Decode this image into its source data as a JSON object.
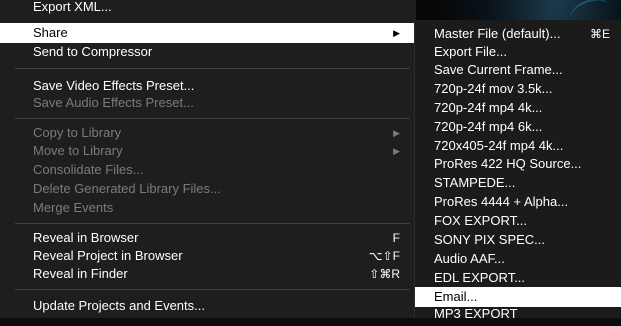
{
  "main_menu": {
    "items": [
      {
        "label": "Export XML...",
        "enabled": true
      },
      {
        "label": "Share",
        "enabled": true,
        "submenu": true,
        "selected": true
      },
      {
        "label": "Send to Compressor",
        "enabled": true
      },
      {
        "label": "Save Video Effects Preset...",
        "enabled": true
      },
      {
        "label": "Save Audio Effects Preset...",
        "enabled": false
      },
      {
        "label": "Copy to Library",
        "enabled": false,
        "submenu": true
      },
      {
        "label": "Move to Library",
        "enabled": false,
        "submenu": true
      },
      {
        "label": "Consolidate Files...",
        "enabled": false
      },
      {
        "label": "Delete Generated Library Files...",
        "enabled": false
      },
      {
        "label": "Merge Events",
        "enabled": false
      },
      {
        "label": "Reveal in Browser",
        "enabled": true,
        "shortcut": "F"
      },
      {
        "label": "Reveal Project in Browser",
        "enabled": true,
        "shortcut": "⌥⇧F"
      },
      {
        "label": "Reveal in Finder",
        "enabled": true,
        "shortcut": "⇧⌘R"
      },
      {
        "label": "Update Projects and Events...",
        "enabled": true
      }
    ],
    "submenu_arrow": "▶"
  },
  "share_submenu": {
    "items": [
      {
        "label": "Master File (default)...",
        "shortcut": "⌘E"
      },
      {
        "label": "Export File..."
      },
      {
        "label": "Save Current Frame..."
      },
      {
        "label": "720p-24f mov 3.5k..."
      },
      {
        "label": "720p-24f mp4 4k..."
      },
      {
        "label": "720p-24f mp4 6k..."
      },
      {
        "label": "720x405-24f mp4 4k..."
      },
      {
        "label": "ProRes 422 HQ Source..."
      },
      {
        "label": "STAMPEDE..."
      },
      {
        "label": "ProRes 4444 + Alpha..."
      },
      {
        "label": "FOX EXPORT..."
      },
      {
        "label": "SONY PIX SPEC..."
      },
      {
        "label": "Audio AAF..."
      },
      {
        "label": "EDL EXPORT..."
      },
      {
        "label": "Email...",
        "selected": true
      },
      {
        "label": "MP3 EXPORT"
      }
    ]
  },
  "colors": {
    "menu_bg": "#1e1e1e",
    "text": "#ffffff",
    "disabled_text": "#7b7b7b",
    "highlight_bg": "#ffffff",
    "highlight_text": "#000000",
    "separator": "#3e3e3e"
  }
}
